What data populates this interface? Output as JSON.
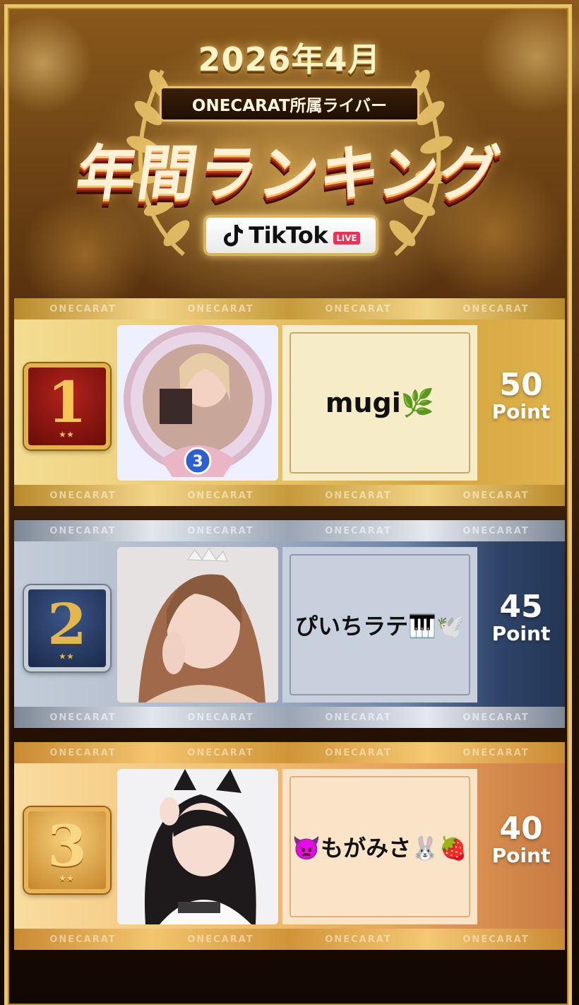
{
  "header": {
    "year_month": "2026年4月",
    "org_label": "ONECARAT所属ライバー",
    "title": "年間ランキング",
    "platform": "TikTok",
    "platform_tag": "LIVE"
  },
  "strip_brand": "ONECARAT",
  "rankings": [
    {
      "rank": "1",
      "name": "mugi🌿",
      "points": "50",
      "unit": "Point"
    },
    {
      "rank": "2",
      "name": "ぴいちラテ🎹🕊️",
      "points": "45",
      "unit": "Point"
    },
    {
      "rank": "3",
      "name": "👿もがみさ🐰🍓",
      "points": "40",
      "unit": "Point"
    }
  ],
  "colors": {
    "gold": "#e8c468",
    "navy": "#233656",
    "bronze": "#e7a25a",
    "tiktok_live": "#fe2c55"
  }
}
